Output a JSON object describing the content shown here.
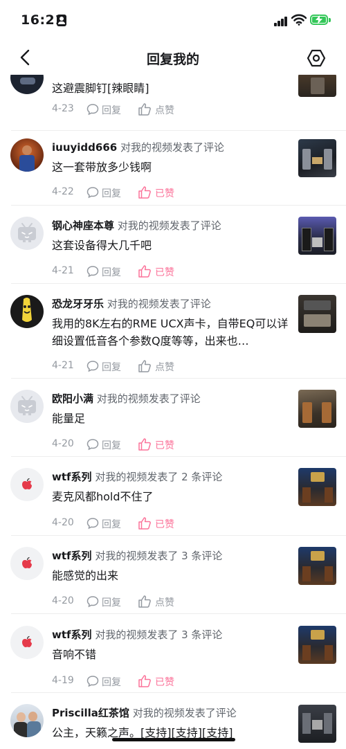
{
  "status_bar": {
    "time": "16:21"
  },
  "header": {
    "title": "回复我的"
  },
  "labels": {
    "reply": "回复",
    "like": "点赞",
    "liked": "已赞"
  },
  "colors": {
    "accent_pink": "#fb7299",
    "meta_gray": "#9499a0"
  },
  "items": [
    {
      "user": "",
      "action": "",
      "content": "这避震脚钉[辣眼睛]",
      "date": "4-23",
      "like_label": "点赞",
      "liked": false,
      "avatar_icon": "dark-photo-avatar"
    },
    {
      "user": "iuuyidd666",
      "action": "对我的视频发表了评论",
      "content": "这一套带放多少钱啊",
      "date": "4-22",
      "like_label": "已赞",
      "liked": true,
      "avatar_icon": "basketball-player-avatar"
    },
    {
      "user": "钢心神座本尊",
      "action": "对我的视频发表了评论",
      "content": "这套设备得大几千吧",
      "date": "4-21",
      "like_label": "已赞",
      "liked": true,
      "avatar_icon": "default-tv-avatar"
    },
    {
      "user": "恐龙牙牙乐",
      "action": "对我的视频发表了评论",
      "content": "我用的8K左右的RME UCX声卡，自带EQ可以详细设置低音各个参数Q度等等，出来也…",
      "date": "4-21",
      "like_label": "点赞",
      "liked": false,
      "avatar_icon": "banana-cartoon-avatar"
    },
    {
      "user": "欧阳小满",
      "action": "对我的视频发表了评论",
      "content": "能量足",
      "date": "4-20",
      "like_label": "已赞",
      "liked": true,
      "avatar_icon": "default-tv-avatar"
    },
    {
      "user": "wtf系列",
      "action": "对我的视频发表了 2 条评论",
      "content": "麦克风都hold不住了",
      "date": "4-20",
      "like_label": "已赞",
      "liked": true,
      "avatar_icon": "apple-logo-avatar"
    },
    {
      "user": "wtf系列",
      "action": "对我的视频发表了 3 条评论",
      "content": "能感觉的出来",
      "date": "4-20",
      "like_label": "点赞",
      "liked": false,
      "avatar_icon": "apple-logo-avatar"
    },
    {
      "user": "wtf系列",
      "action": "对我的视频发表了 3 条评论",
      "content": "音响不错",
      "date": "4-19",
      "like_label": "已赞",
      "liked": true,
      "avatar_icon": "apple-logo-avatar"
    },
    {
      "user": "Priscilla红茶馆",
      "action": "对我的视频发表了评论",
      "content": "公主，天籁之声。[支持][支持][支持]",
      "date": "",
      "like_label": "",
      "liked": false,
      "avatar_icon": "couple-photo-avatar"
    }
  ]
}
